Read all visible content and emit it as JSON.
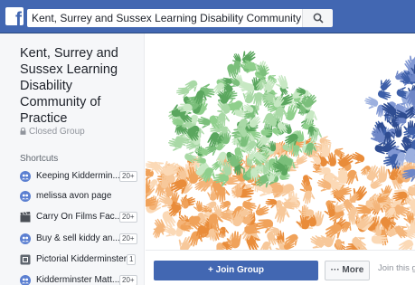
{
  "topbar": {
    "logo_letter": "f",
    "search_value": "Kent, Surrey and Sussex Learning Disability Community of ..."
  },
  "group": {
    "title": "Kent, Surrey and Sussex Learning Disability Community of Practice",
    "privacy": "Closed Group"
  },
  "shortcuts": {
    "heading": "Shortcuts",
    "items": [
      {
        "label": "Keeping Kiddermin...",
        "badge": "20+",
        "icon": "group-icon"
      },
      {
        "label": "melissa avon page",
        "badge": "",
        "icon": "group-icon"
      },
      {
        "label": "Carry On Films Fac...",
        "badge": "20+",
        "icon": "film-icon"
      },
      {
        "label": "Buy & sell kiddy an...",
        "badge": "20+",
        "icon": "group-icon"
      },
      {
        "label": "Pictorial Kidderminster",
        "badge": "1",
        "icon": "page-icon"
      },
      {
        "label": "Kidderminster Matt...",
        "badge": "20+",
        "icon": "group-icon"
      }
    ]
  },
  "actions": {
    "join_label": "+ Join Group",
    "more_label": "··· More",
    "hint": "Join this gr"
  },
  "colors": {
    "brand": "#4267b2",
    "hands_green": "#7bbf7b",
    "hands_orange": "#f0a25a",
    "hands_blue": "#4f6fb8"
  }
}
